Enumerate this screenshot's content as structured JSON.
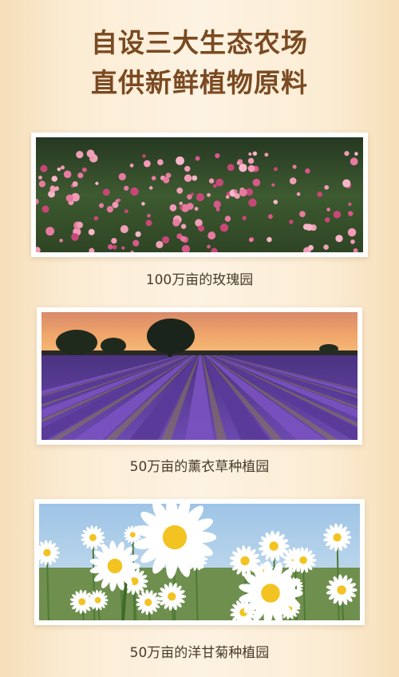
{
  "headline": {
    "line1": "自设三大生态农场",
    "line2": "直供新鲜植物原料"
  },
  "gardens": [
    {
      "caption": "100万亩的玫瑰园",
      "image": "rose-garden-photo"
    },
    {
      "caption": "50万亩的薰衣草种植园",
      "image": "lavender-field-photo"
    },
    {
      "caption": "50万亩的洋甘菊种植园",
      "image": "chamomile-field-photo"
    }
  ]
}
